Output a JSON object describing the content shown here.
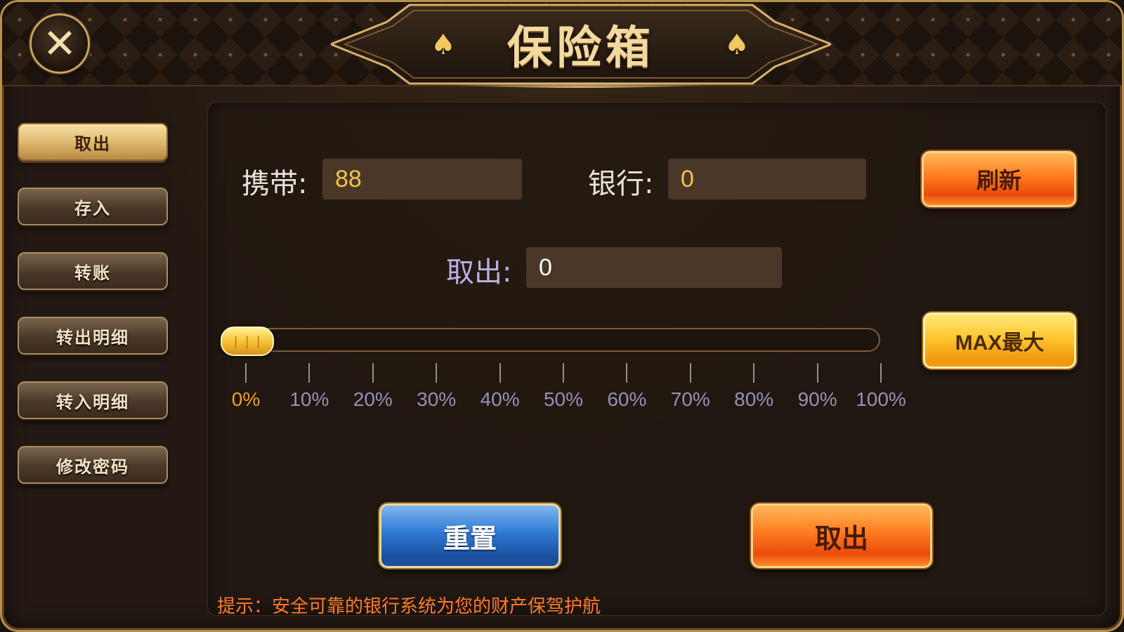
{
  "title": "保险箱",
  "close_icon": "close-icon",
  "sidebar": {
    "items": [
      {
        "label": "取出",
        "active": true
      },
      {
        "label": "存入",
        "active": false
      },
      {
        "label": "转账",
        "active": false
      },
      {
        "label": "转出明细",
        "active": false
      },
      {
        "label": "转入明细",
        "active": false
      },
      {
        "label": "修改密码",
        "active": false
      }
    ]
  },
  "form": {
    "carry_label": "携带:",
    "carry_value": "88",
    "bank_label": "银行:",
    "bank_value": "0",
    "withdraw_label": "取出:",
    "withdraw_value": "0"
  },
  "buttons": {
    "refresh": "刷新",
    "max": "MAX最大",
    "reset": "重置",
    "withdraw": "取出"
  },
  "slider": {
    "value_percent": 0,
    "ticks": [
      "0%",
      "10%",
      "20%",
      "30%",
      "40%",
      "50%",
      "60%",
      "70%",
      "80%",
      "90%",
      "100%"
    ]
  },
  "hint": "提示：安全可靠的银行系统为您的财产保驾护航",
  "colors": {
    "gold": "#dcb46a",
    "orange_button": "#ff7b1e",
    "blue_button": "#2f7ad4",
    "hint_text": "#ff7a2a",
    "field_value": "#f0c44a",
    "field_bg": "#4b3727"
  }
}
